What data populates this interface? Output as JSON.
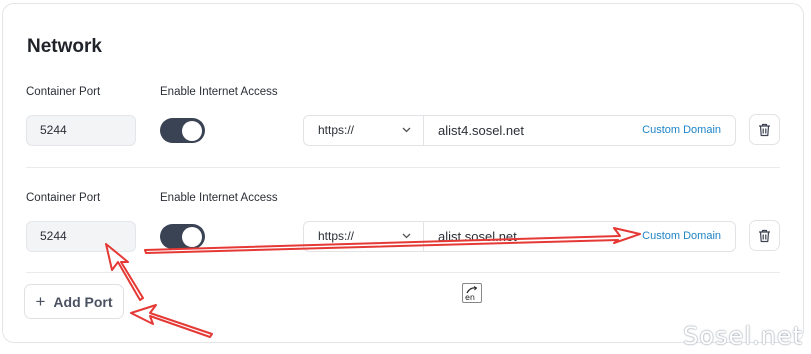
{
  "network": {
    "title": "Network",
    "ports": [
      {
        "port_label": "Container Port",
        "port_value": "5244",
        "internet_label": "Enable Internet Access",
        "internet_enabled": true,
        "protocol": "https://",
        "domain": "alist4.sosel.net",
        "custom_domain_label": "Custom Domain"
      },
      {
        "port_label": "Container Port",
        "port_value": "5244",
        "internet_label": "Enable Internet Access",
        "internet_enabled": true,
        "protocol": "https://",
        "domain": "alist.sosel.net",
        "custom_domain_label": "Custom Domain"
      }
    ],
    "add_port_label": "Add Port"
  },
  "ime_indicator": "en",
  "watermark": "Sosel.net",
  "colors": {
    "toggle_on": "#3a4353",
    "link": "#1f84c7",
    "annotation": "#e53935"
  },
  "icons": [
    "trash-icon",
    "chevron-down-icon",
    "plus-icon",
    "ime-icon"
  ]
}
